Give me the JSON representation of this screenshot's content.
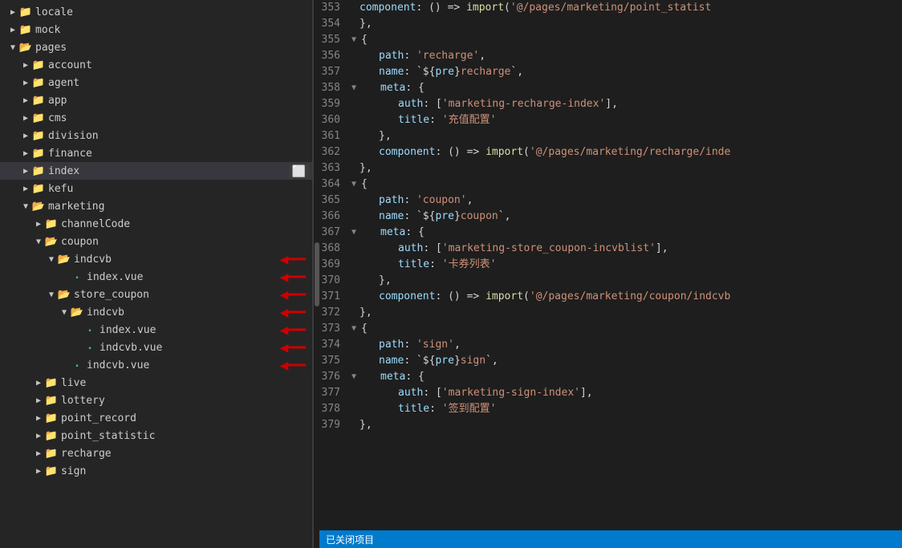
{
  "sidebar": {
    "items": [
      {
        "id": "locale",
        "label": "locale",
        "type": "folder",
        "level": 1,
        "expanded": false,
        "chevron": "▶"
      },
      {
        "id": "mock",
        "label": "mock",
        "type": "folder",
        "level": 1,
        "expanded": false,
        "chevron": "▶"
      },
      {
        "id": "pages",
        "label": "pages",
        "type": "folder",
        "level": 1,
        "expanded": true,
        "chevron": "▼"
      },
      {
        "id": "account",
        "label": "account",
        "type": "folder",
        "level": 2,
        "expanded": false,
        "chevron": "▶"
      },
      {
        "id": "agent",
        "label": "agent",
        "type": "folder",
        "level": 2,
        "expanded": false,
        "chevron": "▶"
      },
      {
        "id": "app",
        "label": "app",
        "type": "folder",
        "level": 2,
        "expanded": false,
        "chevron": "▶"
      },
      {
        "id": "cms",
        "label": "cms",
        "type": "folder",
        "level": 2,
        "expanded": false,
        "chevron": "▶"
      },
      {
        "id": "division",
        "label": "division",
        "type": "folder",
        "level": 2,
        "expanded": false,
        "chevron": "▶"
      },
      {
        "id": "finance",
        "label": "finance",
        "type": "folder",
        "level": 2,
        "expanded": false,
        "chevron": "▶"
      },
      {
        "id": "index",
        "label": "index",
        "type": "folder",
        "level": 2,
        "expanded": false,
        "chevron": "▶",
        "selected": true
      },
      {
        "id": "kefu",
        "label": "kefu",
        "type": "folder",
        "level": 2,
        "expanded": false,
        "chevron": "▶"
      },
      {
        "id": "marketing",
        "label": "marketing",
        "type": "folder",
        "level": 2,
        "expanded": true,
        "chevron": "▼"
      },
      {
        "id": "channelCode",
        "label": "channelCode",
        "type": "folder",
        "level": 3,
        "expanded": false,
        "chevron": "▶"
      },
      {
        "id": "coupon",
        "label": "coupon",
        "type": "folder",
        "level": 3,
        "expanded": true,
        "chevron": "▼"
      },
      {
        "id": "indcvb",
        "label": "indcvb",
        "type": "folder",
        "level": 4,
        "expanded": true,
        "chevron": "▼",
        "hasArrow": true
      },
      {
        "id": "index.vue1",
        "label": "index.vue",
        "type": "vue",
        "level": 5,
        "hasArrow": true
      },
      {
        "id": "store_coupon",
        "label": "store_coupon",
        "type": "folder",
        "level": 4,
        "expanded": true,
        "chevron": "▼",
        "hasArrow": true
      },
      {
        "id": "indcvb2",
        "label": "indcvb",
        "type": "folder",
        "level": 5,
        "expanded": true,
        "chevron": "▼",
        "hasArrow": true
      },
      {
        "id": "index.vue2",
        "label": "index.vue",
        "type": "vue",
        "level": 6,
        "hasArrow": true
      },
      {
        "id": "indcvb.vue1",
        "label": "indcvb.vue",
        "type": "vue",
        "level": 6,
        "hasArrow": true
      },
      {
        "id": "indcvb.vue2",
        "label": "indcvb.vue",
        "type": "vue",
        "level": 5,
        "hasArrow": true
      },
      {
        "id": "live",
        "label": "live",
        "type": "folder",
        "level": 3,
        "expanded": false,
        "chevron": "▶"
      },
      {
        "id": "lottery",
        "label": "lottery",
        "type": "folder",
        "level": 3,
        "expanded": false,
        "chevron": "▶"
      },
      {
        "id": "point_record",
        "label": "point_record",
        "type": "folder",
        "level": 3,
        "expanded": false,
        "chevron": "▶"
      },
      {
        "id": "point_statistic",
        "label": "point_statistic",
        "type": "folder",
        "level": 3,
        "expanded": false,
        "chevron": "▶"
      },
      {
        "id": "recharge",
        "label": "recharge",
        "type": "folder",
        "level": 3,
        "expanded": false,
        "chevron": "▶"
      },
      {
        "id": "sign",
        "label": "sign",
        "type": "folder",
        "level": 3,
        "expanded": false,
        "chevron": "▶"
      }
    ]
  },
  "editor": {
    "lines": [
      {
        "num": 353,
        "fold": false,
        "content": "component_line",
        "indent": "      ",
        "text": "component: () => import('@/pages/marketing/point_statist"
      },
      {
        "num": 354,
        "fold": false,
        "content": "brace_line",
        "text": "    },"
      },
      {
        "num": 355,
        "fold": true,
        "content": "open_brace",
        "text": "    {"
      },
      {
        "num": 356,
        "fold": false,
        "content": "path_line",
        "key": "path",
        "value": "'recharge'"
      },
      {
        "num": 357,
        "fold": false,
        "content": "name_line",
        "key": "name",
        "value": "`${pre}recharge`"
      },
      {
        "num": 358,
        "fold": true,
        "content": "meta_open",
        "key": "meta"
      },
      {
        "num": 359,
        "fold": false,
        "content": "auth_line",
        "key": "auth",
        "value": "['marketing-recharge-index']"
      },
      {
        "num": 360,
        "fold": false,
        "content": "title_line",
        "key": "title",
        "value": "'充值配置'"
      },
      {
        "num": 361,
        "fold": false,
        "content": "close_meta",
        "text": "      },"
      },
      {
        "num": 362,
        "fold": false,
        "content": "component_line2",
        "text": "      component: () => import('@/pages/marketing/recharge/inde"
      },
      {
        "num": 363,
        "fold": false,
        "content": "close_obj",
        "text": "    },"
      },
      {
        "num": 364,
        "fold": true,
        "content": "open_brace2",
        "text": "    {"
      },
      {
        "num": 365,
        "fold": false,
        "content": "path_coupon",
        "key": "path",
        "value": "'coupon'"
      },
      {
        "num": 366,
        "fold": false,
        "content": "name_coupon",
        "key": "name",
        "value": "`${pre}coupon`"
      },
      {
        "num": 367,
        "fold": true,
        "content": "meta_coupon",
        "key": "meta"
      },
      {
        "num": 368,
        "fold": false,
        "content": "auth_coupon",
        "key": "auth",
        "value": "['marketing-store_coupon-incvblist']"
      },
      {
        "num": 369,
        "fold": false,
        "content": "title_coupon",
        "key": "title",
        "value": "'卡券列表'"
      },
      {
        "num": 370,
        "fold": false,
        "content": "close_meta2",
        "text": "      },"
      },
      {
        "num": 371,
        "fold": false,
        "content": "component_coupon",
        "text": "      component: () => import('@/pages/marketing/coupon/indcvb"
      },
      {
        "num": 372,
        "fold": false,
        "content": "close_obj2",
        "text": "    },"
      },
      {
        "num": 373,
        "fold": true,
        "content": "open_brace3",
        "text": "    {"
      },
      {
        "num": 374,
        "fold": false,
        "content": "path_sign",
        "key": "path",
        "value": "'sign'"
      },
      {
        "num": 375,
        "fold": false,
        "content": "name_sign",
        "key": "name",
        "value": "`${pre}sign`"
      },
      {
        "num": 376,
        "fold": true,
        "content": "meta_sign",
        "key": "meta"
      },
      {
        "num": 377,
        "fold": false,
        "content": "auth_sign",
        "key": "auth",
        "value": "['marketing-sign-index']"
      },
      {
        "num": 378,
        "fold": false,
        "content": "title_sign",
        "key": "title",
        "value": "'签到配置'"
      },
      {
        "num": 379,
        "fold": false,
        "content": "close_sign",
        "text": "    },"
      }
    ]
  },
  "bottomBar": {
    "text": "已关闭项目"
  }
}
